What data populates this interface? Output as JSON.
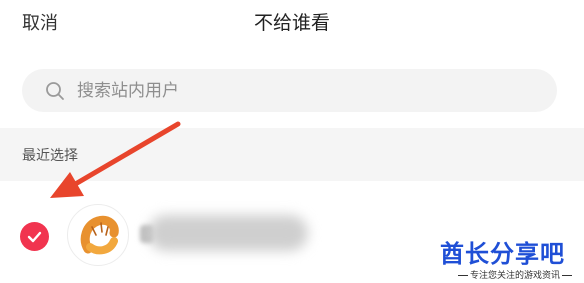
{
  "header": {
    "cancel_label": "取消",
    "title": "不给谁看"
  },
  "search": {
    "placeholder": "搜索站内用户"
  },
  "recent": {
    "section_label": "最近选择",
    "items": [
      {
        "selected": true,
        "avatar_icon": "croissant-icon"
      }
    ]
  },
  "annotation": {
    "arrow_color": "#e8452c"
  },
  "colors": {
    "check": "#f1344f",
    "search_bg": "#f3f3f3",
    "section_bg": "#f5f5f5"
  },
  "watermark": {
    "brand": "酋长分享吧",
    "tagline": "专注您关注的游戏资讯"
  }
}
